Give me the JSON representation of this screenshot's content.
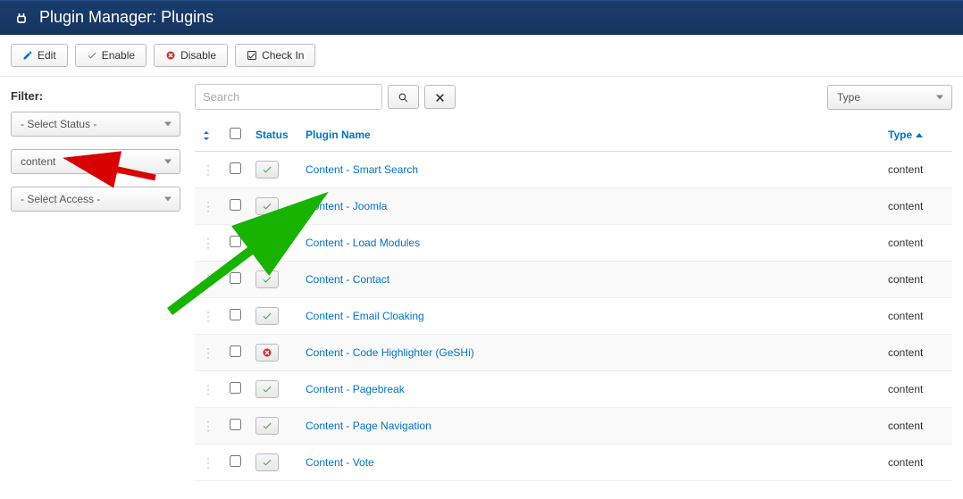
{
  "header": {
    "title": "Plugin Manager: Plugins"
  },
  "toolbar": {
    "edit_label": "Edit",
    "enable_label": "Enable",
    "disable_label": "Disable",
    "checkin_label": "Check In"
  },
  "sidebar": {
    "filter_label": "Filter:",
    "status_select": "- Select Status -",
    "type_select": "content",
    "access_select": "- Select Access -"
  },
  "search": {
    "placeholder": "Search"
  },
  "top_right_select": "Type",
  "columns": {
    "status": "Status",
    "plugin_name": "Plugin Name",
    "type": "Type"
  },
  "rows": [
    {
      "name": "Content - Smart Search",
      "type": "content",
      "enabled": true
    },
    {
      "name": "Content - Joomla",
      "type": "content",
      "enabled": true
    },
    {
      "name": "Content - Load Modules",
      "type": "content",
      "enabled": true
    },
    {
      "name": "Content - Contact",
      "type": "content",
      "enabled": true
    },
    {
      "name": "Content - Email Cloaking",
      "type": "content",
      "enabled": true
    },
    {
      "name": "Content - Code Highlighter (GeSHi)",
      "type": "content",
      "enabled": false
    },
    {
      "name": "Content - Pagebreak",
      "type": "content",
      "enabled": true
    },
    {
      "name": "Content - Page Navigation",
      "type": "content",
      "enabled": true
    },
    {
      "name": "Content - Vote",
      "type": "content",
      "enabled": true
    }
  ],
  "annotations": {
    "red_arrow_target": "type-filter-select",
    "green_arrow_target": "row-load-modules"
  }
}
